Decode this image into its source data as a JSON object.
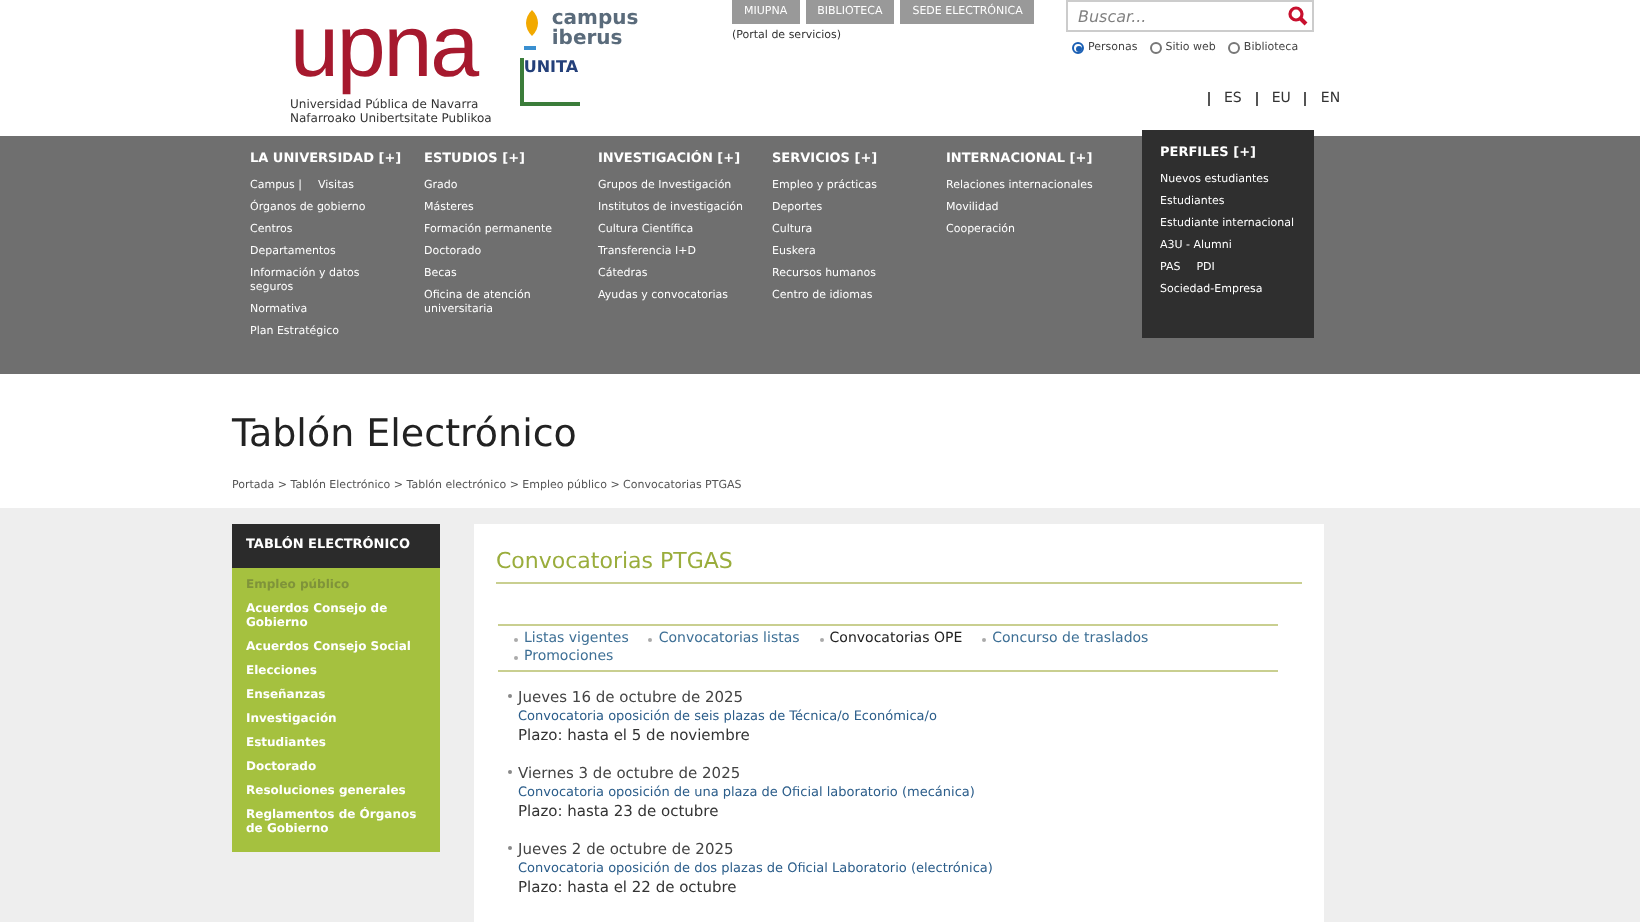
{
  "header": {
    "logo": "upna",
    "logo_subtitle": [
      "Universidad Pública de Navarra",
      "Nafarroako Unibertsitate Publikoa"
    ],
    "campus_logo": [
      "campus",
      "iberus"
    ],
    "unita_logo": "UNITA",
    "top_buttons": [
      {
        "label": "MIUPNA"
      },
      {
        "label": "BIBLIOTECA"
      },
      {
        "label": "SEDE ELECTRÓNICA"
      }
    ],
    "portal_note": "(Portal de servicios)",
    "search": {
      "placeholder": "Buscar..."
    },
    "search_scope": [
      {
        "label": "Personas",
        "selected": true
      },
      {
        "label": "Sitio web",
        "selected": false
      },
      {
        "label": "Biblioteca",
        "selected": false
      }
    ],
    "languages": [
      "ES",
      "EU",
      "EN"
    ]
  },
  "nav": [
    {
      "title": "LA UNIVERSIDAD [+]",
      "highlighted": false,
      "rows": [
        [
          "Campus |",
          "Visitas"
        ],
        [
          "Órganos de gobierno"
        ],
        [
          "Centros"
        ],
        [
          "Departamentos"
        ],
        [
          "Información y datos seguros"
        ],
        [
          "Normativa"
        ],
        [
          "Plan Estratégico"
        ]
      ]
    },
    {
      "title": "ESTUDIOS [+]",
      "highlighted": false,
      "rows": [
        [
          "Grado"
        ],
        [
          "Másteres"
        ],
        [
          "Formación permanente"
        ],
        [
          "Doctorado"
        ],
        [
          "Becas"
        ],
        [
          "Oficina de atención universitaria"
        ]
      ]
    },
    {
      "title": "INVESTIGACIÓN [+]",
      "highlighted": false,
      "rows": [
        [
          "Grupos de Investigación"
        ],
        [
          "Institutos de investigación"
        ],
        [
          "Cultura Científica"
        ],
        [
          "Transferencia I+D"
        ],
        [
          "Cátedras"
        ],
        [
          "Ayudas y convocatorias"
        ]
      ]
    },
    {
      "title": "SERVICIOS [+]",
      "highlighted": false,
      "rows": [
        [
          "Empleo y prácticas"
        ],
        [
          "Deportes"
        ],
        [
          "Cultura"
        ],
        [
          "Euskera"
        ],
        [
          "Recursos humanos"
        ],
        [
          "Centro de idiomas"
        ]
      ]
    },
    {
      "title": "INTERNACIONAL [+]",
      "highlighted": false,
      "rows": [
        [
          "Relaciones internacionales"
        ],
        [
          "Movilidad"
        ],
        [
          "Cooperación"
        ]
      ]
    },
    {
      "title": "PERFILES [+]",
      "highlighted": true,
      "rows": [
        [
          "Nuevos estudiantes"
        ],
        [
          "Estudiantes"
        ],
        [
          "Estudiante internacional"
        ],
        [
          "A3U - Alumni"
        ],
        [
          "PAS",
          "PDI"
        ],
        [
          "Sociedad-Empresa"
        ]
      ]
    }
  ],
  "page_title": "Tablón Electrónico",
  "breadcrumb": "Portada > Tablón Electrónico > Tablón electrónico > Empleo público > Convocatorias PTGAS",
  "sidebar": {
    "title": "TABLÓN ELECTRÓNICO",
    "items": [
      {
        "label": "Empleo público",
        "selected": true
      },
      {
        "label": "Acuerdos Consejo de Gobierno",
        "selected": false
      },
      {
        "label": "Acuerdos Consejo Social",
        "selected": false
      },
      {
        "label": "Elecciones",
        "selected": false
      },
      {
        "label": "Enseñanzas",
        "selected": false
      },
      {
        "label": "Investigación",
        "selected": false
      },
      {
        "label": "Estudiantes",
        "selected": false
      },
      {
        "label": "Doctorado",
        "selected": false
      },
      {
        "label": "Resoluciones generales",
        "selected": false
      },
      {
        "label": "Reglamentos de Órganos de Gobierno",
        "selected": false
      }
    ]
  },
  "content": {
    "title": "Convocatorias PTGAS",
    "tabs": [
      {
        "label": "Listas vigentes",
        "selected": false
      },
      {
        "label": "Convocatorias listas",
        "selected": false
      },
      {
        "label": "Convocatorias OPE",
        "selected": true
      },
      {
        "label": "Concurso de traslados",
        "selected": false
      },
      {
        "label": "Promociones",
        "selected": false
      }
    ],
    "entries": [
      {
        "date": "Jueves 16 de octubre de 2025",
        "link": "Convocatoria oposición de seis plazas de Técnica/o Económica/o",
        "deadline": "Plazo: hasta el 5 de noviembre"
      },
      {
        "date": "Viernes 3 de octubre de 2025",
        "link": "Convocatoria oposición de una plaza de Oficial laboratorio (mecánica)",
        "deadline": "Plazo: hasta 23 de octubre"
      },
      {
        "date": "Jueves 2 de octubre de 2025",
        "link": "Convocatoria oposición de dos plazas de Oficial Laboratorio (electrónica)",
        "deadline": "Plazo: hasta el 22 de octubre"
      }
    ]
  }
}
